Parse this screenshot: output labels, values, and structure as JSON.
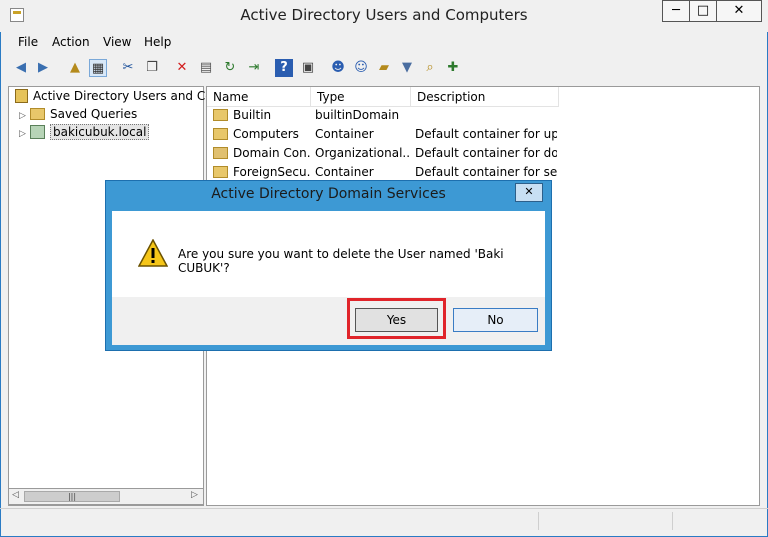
{
  "window": {
    "title": "Active Directory Users and Computers",
    "controls": {
      "minimize": "─",
      "maximize": "□",
      "close": "✕"
    }
  },
  "menu": [
    "File",
    "Action",
    "View",
    "Help"
  ],
  "toolbar_icons": [
    "back-icon",
    "forward-icon",
    "up-folder-icon",
    "show-console-tree-icon",
    "cut-icon",
    "copy-icon",
    "delete-icon",
    "properties-icon",
    "refresh-icon",
    "export-list-icon",
    "help-icon",
    "show-hide-icon",
    "create-user-icon",
    "create-group-icon",
    "create-ou-icon",
    "filter-icon",
    "find-icon",
    "add-to-group-icon"
  ],
  "tree": {
    "root": "Active Directory Users and Com",
    "items": [
      {
        "label": "Saved Queries"
      },
      {
        "label": "bakicubuk.local"
      }
    ]
  },
  "list": {
    "columns": [
      "Name",
      "Type",
      "Description"
    ],
    "rows": [
      {
        "name": "Builtin",
        "type": "builtinDomain",
        "description": ""
      },
      {
        "name": "Computers",
        "type": "Container",
        "description": "Default container for up..."
      },
      {
        "name": "Domain Con...",
        "type": "Organizational...",
        "description": "Default container for do..."
      },
      {
        "name": "ForeignSecu...",
        "type": "Container",
        "description": "Default container for sec..."
      }
    ]
  },
  "dialog": {
    "title": "Active Directory Domain Services",
    "close": "✕",
    "message": "Are you sure you want to delete the User named 'Baki CUBUK'?",
    "yes_label": "Yes",
    "no_label": "No"
  },
  "highlight_color": "#e0242a"
}
